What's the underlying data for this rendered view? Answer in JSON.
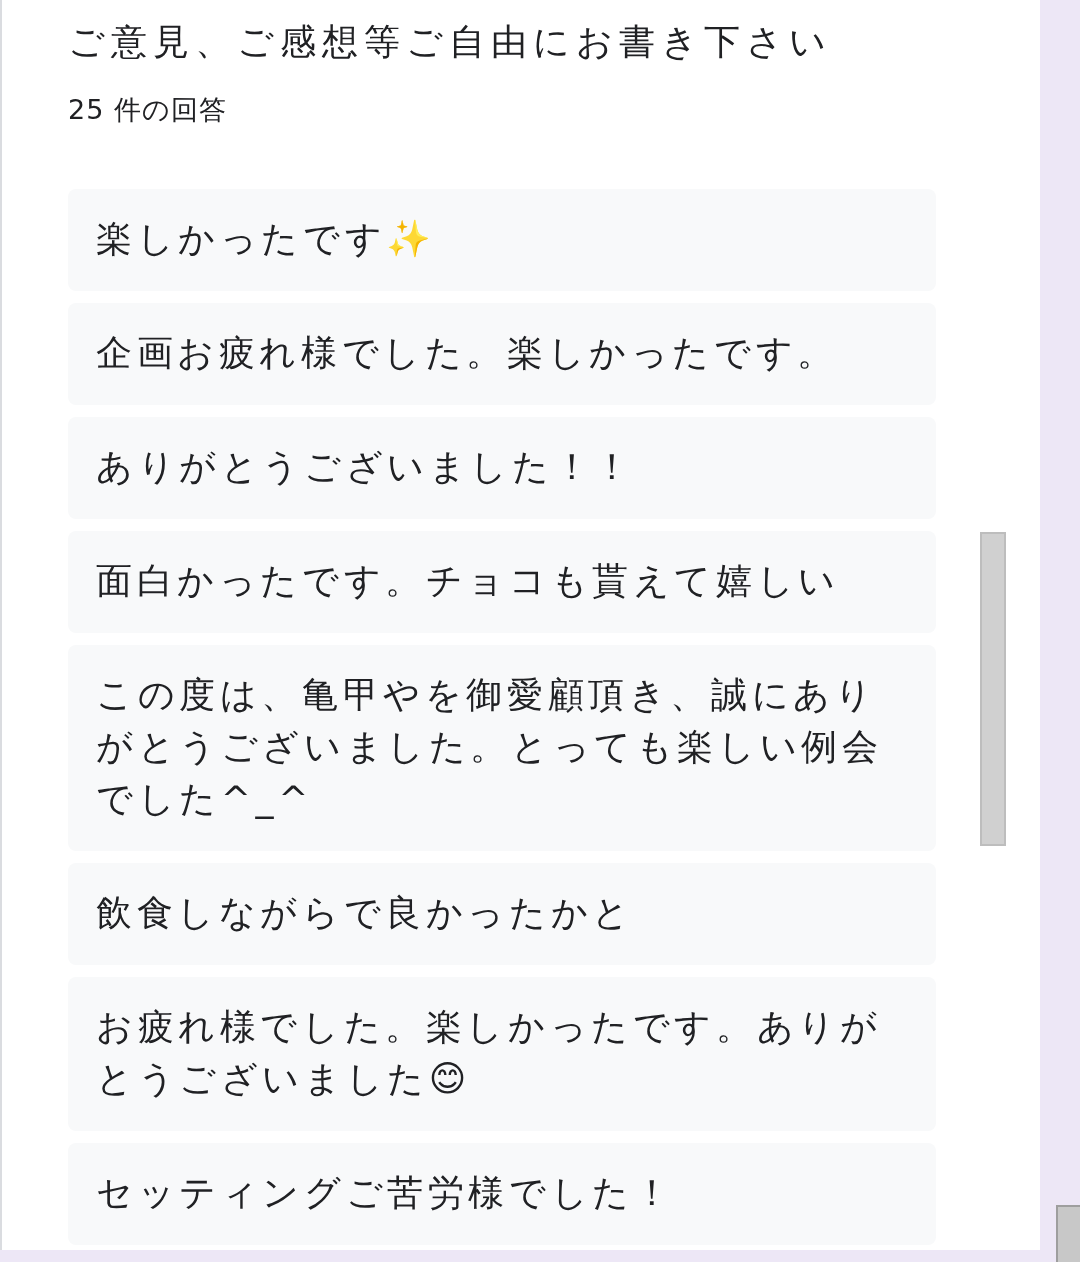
{
  "question": {
    "title": "ご意見、ご感想等ご自由にお書き下さい",
    "count": "25 件の回答"
  },
  "responses": [
    "楽しかったです✨",
    "企画お疲れ様でした。楽しかったです。",
    "ありがとうございました！！",
    "面白かったです。チョコも貰えて嬉しい",
    "この度は、亀甲やを御愛顧頂き、誠にありがとうございました。とっても楽しい例会でした^_^",
    "飲食しながらで良かったかと",
    "お疲れ様でした。楽しかったです。ありがとうございました😊",
    "セッティングご苦労様でした！"
  ]
}
